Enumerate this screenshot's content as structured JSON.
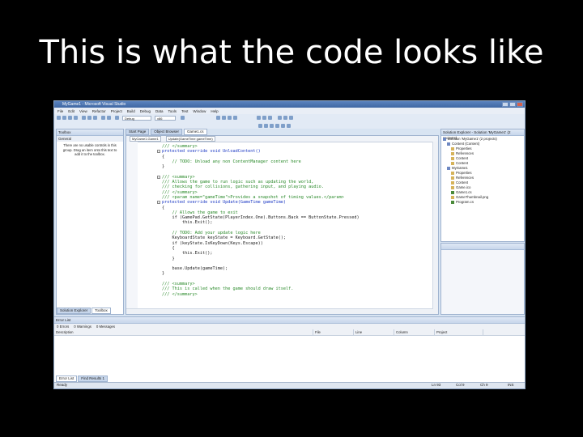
{
  "slide": {
    "title": "This is what the code looks like"
  },
  "window": {
    "title": "MyGame1 - Microsoft Visual Studio"
  },
  "menu": [
    "File",
    "Edit",
    "View",
    "Refactor",
    "Project",
    "Build",
    "Debug",
    "Data",
    "Tools",
    "Test",
    "Window",
    "Help"
  ],
  "toolbar": {
    "config": "Debug",
    "platform": "x86"
  },
  "toolbox": {
    "title": "Toolbox",
    "group": "General",
    "message": "There are no usable controls in this group. Drag an item onto this text to add it to the toolbox.",
    "tabs": [
      "Solution Explorer",
      "Toolbox"
    ]
  },
  "editor": {
    "tabs": [
      "Start Page",
      "Object Browser",
      "Game1.cs"
    ],
    "dropdowns": [
      "MyGame1.Game1",
      "Update(GameTime gameTime)"
    ],
    "lines": [
      {
        "t": "/// </summary>",
        "c": "comment"
      },
      {
        "t": "protected override void UnloadContent()",
        "c": "key"
      },
      {
        "t": "{",
        "c": ""
      },
      {
        "t": "    // TODO: Unload any non ContentManager content here",
        "c": "comment"
      },
      {
        "t": "}",
        "c": ""
      },
      {
        "t": "",
        "c": ""
      },
      {
        "t": "/// <summary>",
        "c": "comment"
      },
      {
        "t": "/// Allows the game to run logic such as updating the world,",
        "c": "comment"
      },
      {
        "t": "/// checking for collisions, gathering input, and playing audio.",
        "c": "comment"
      },
      {
        "t": "/// </summary>",
        "c": "comment"
      },
      {
        "t": "/// <param name=\"gameTime\">Provides a snapshot of timing values.</param>",
        "c": "comment"
      },
      {
        "t": "protected override void Update(GameTime gameTime)",
        "c": "key"
      },
      {
        "t": "{",
        "c": ""
      },
      {
        "t": "    // Allows the game to exit",
        "c": "comment"
      },
      {
        "t": "    if (GamePad.GetState(PlayerIndex.One).Buttons.Back == ButtonState.Pressed)",
        "c": ""
      },
      {
        "t": "        this.Exit();",
        "c": ""
      },
      {
        "t": "",
        "c": ""
      },
      {
        "t": "    // TODO: Add your update logic here",
        "c": "comment"
      },
      {
        "t": "    KeyboardState keyState = Keyboard.GetState();",
        "c": ""
      },
      {
        "t": "    if (keyState.IsKeyDown(Keys.Escape))",
        "c": ""
      },
      {
        "t": "    {",
        "c": ""
      },
      {
        "t": "        this.Exit();",
        "c": ""
      },
      {
        "t": "    }",
        "c": ""
      },
      {
        "t": "",
        "c": ""
      },
      {
        "t": "    base.Update(gameTime);",
        "c": ""
      },
      {
        "t": "}",
        "c": ""
      },
      {
        "t": "",
        "c": ""
      },
      {
        "t": "/// <summary>",
        "c": "comment"
      },
      {
        "t": "/// This is called when the game should draw itself.",
        "c": "comment"
      },
      {
        "t": "/// </summary>",
        "c": "comment"
      }
    ]
  },
  "solution": {
    "title": "Solution Explorer - Solution 'MyGame1' (2 projects)",
    "items": [
      {
        "label": "Solution 'MyGame1' (2 projects)",
        "indent": 0,
        "icon": "solution"
      },
      {
        "label": "Content (Content)",
        "indent": 1,
        "icon": "proj"
      },
      {
        "label": "Properties",
        "indent": 2,
        "icon": "folder"
      },
      {
        "label": "References",
        "indent": 2,
        "icon": "folder"
      },
      {
        "label": "Content",
        "indent": 2,
        "icon": "folder"
      },
      {
        "label": "Content",
        "indent": 2,
        "icon": "folder"
      },
      {
        "label": "MyGame1",
        "indent": 1,
        "icon": "proj"
      },
      {
        "label": "Properties",
        "indent": 2,
        "icon": "folder"
      },
      {
        "label": "References",
        "indent": 2,
        "icon": "folder"
      },
      {
        "label": "Content",
        "indent": 2,
        "icon": "folder"
      },
      {
        "label": "Game.ico",
        "indent": 2,
        "icon": "file"
      },
      {
        "label": "Game1.cs",
        "indent": 2,
        "icon": "cs"
      },
      {
        "label": "GameThumbnail.png",
        "indent": 2,
        "icon": "file"
      },
      {
        "label": "Program.cs",
        "indent": 2,
        "icon": "cs"
      }
    ]
  },
  "errorlist": {
    "title": "Error List",
    "filters": [
      "0 Errors",
      "0 Warnings",
      "0 Messages"
    ],
    "columns": [
      "Description",
      "File",
      "Line",
      "Column",
      "Project"
    ],
    "tabs": [
      "Error List",
      "Find Results 1"
    ]
  },
  "status": {
    "left": "Ready",
    "ln": "Ln 93",
    "col": "Col 9",
    "ch": "Ch 9",
    "ins": "INS"
  },
  "colors": {
    "accent": "#3f67a3",
    "background": "#000000"
  }
}
